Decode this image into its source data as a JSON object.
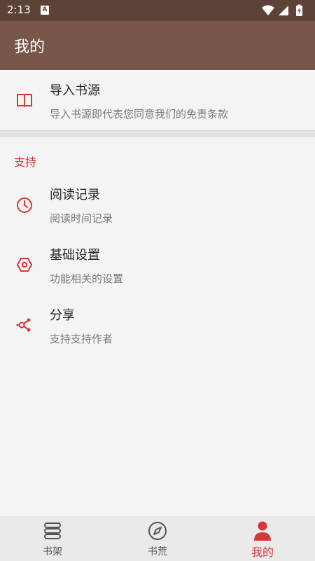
{
  "status": {
    "time": "2:13",
    "notif_letter": "A"
  },
  "app_bar": {
    "title": "我的"
  },
  "import_source": {
    "title": "导入书源",
    "subtitle": "导入书源即代表您同意我们的免责条款",
    "icon": "book-open-icon"
  },
  "support_section": {
    "header": "支持",
    "items": [
      {
        "title": "阅读记录",
        "subtitle": "阅读时间记录",
        "icon": "clock-icon"
      },
      {
        "title": "基础设置",
        "subtitle": "功能相关的设置",
        "icon": "hexagon-settings-icon"
      },
      {
        "title": "分享",
        "subtitle": "支持支持作者",
        "icon": "share-icon"
      }
    ]
  },
  "bottom_nav": {
    "items": [
      {
        "label": "书架",
        "icon": "bookshelf-icon",
        "active": false
      },
      {
        "label": "书荒",
        "icon": "compass-icon",
        "active": false
      },
      {
        "label": "我的",
        "icon": "person-icon",
        "active": true
      }
    ]
  },
  "colors": {
    "status_bar": "#5d4337",
    "app_bar": "#785548",
    "accent": "#d9363a",
    "background": "#f4f4f4"
  }
}
